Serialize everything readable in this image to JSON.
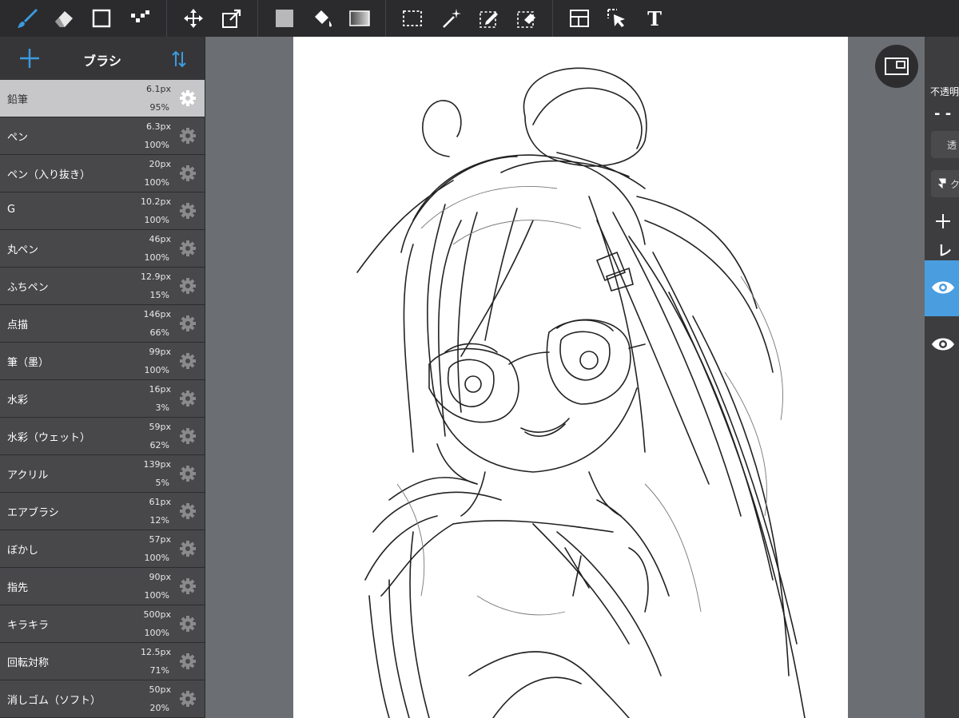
{
  "toolbar": {
    "tools": [
      {
        "name": "brush-tool",
        "icon": "brush-icon",
        "active": true
      },
      {
        "name": "eraser-tool",
        "icon": "eraser-icon"
      },
      {
        "name": "shape-tool",
        "icon": "square-icon"
      },
      {
        "name": "dot-tool",
        "icon": "dots-icon"
      },
      {
        "name": "move-tool",
        "icon": "move-icon"
      },
      {
        "name": "transform-tool",
        "icon": "transform-icon"
      },
      {
        "name": "color-tool",
        "icon": "color-swatch-icon"
      },
      {
        "name": "fill-tool",
        "icon": "bucket-icon"
      },
      {
        "name": "gradient-tool",
        "icon": "gradient-icon"
      },
      {
        "name": "select-rect-tool",
        "icon": "selection-rect-icon"
      },
      {
        "name": "magic-wand-tool",
        "icon": "magic-wand-icon"
      },
      {
        "name": "select-pen-tool",
        "icon": "selection-pen-icon"
      },
      {
        "name": "select-eraser-tool",
        "icon": "selection-eraser-icon"
      },
      {
        "name": "panel-layout-tool",
        "icon": "layout-icon"
      },
      {
        "name": "select-layer-tool",
        "icon": "cursor-select-icon"
      },
      {
        "name": "text-tool",
        "icon": "text-icon"
      }
    ],
    "text_tool_label": "T",
    "accent": "#3b9be0"
  },
  "sidebar": {
    "title": "ブラシ",
    "brushes": [
      {
        "name": "鉛筆",
        "size": "6.1px",
        "opacity": "95%",
        "selected": true
      },
      {
        "name": "ペン",
        "size": "6.3px",
        "opacity": "100%"
      },
      {
        "name": "ペン（入り抜き）",
        "size": "20px",
        "opacity": "100%"
      },
      {
        "name": "G",
        "size": "10.2px",
        "opacity": "100%"
      },
      {
        "name": "丸ペン",
        "size": "46px",
        "opacity": "100%"
      },
      {
        "name": "ふちペン",
        "size": "12.9px",
        "opacity": "15%"
      },
      {
        "name": "点描",
        "size": "146px",
        "opacity": "66%"
      },
      {
        "name": "筆（墨）",
        "size": "99px",
        "opacity": "100%"
      },
      {
        "name": "水彩",
        "size": "16px",
        "opacity": "3%"
      },
      {
        "name": "水彩（ウェット）",
        "size": "59px",
        "opacity": "62%"
      },
      {
        "name": "アクリル",
        "size": "139px",
        "opacity": "5%"
      },
      {
        "name": "エアブラシ",
        "size": "61px",
        "opacity": "12%"
      },
      {
        "name": "ぼかし",
        "size": "57px",
        "opacity": "100%"
      },
      {
        "name": "指先",
        "size": "90px",
        "opacity": "100%"
      },
      {
        "name": "キラキラ",
        "size": "500px",
        "opacity": "100%"
      },
      {
        "name": "回転対称",
        "size": "12.5px",
        "opacity": "71%"
      },
      {
        "name": "消しゴム（ソフト）",
        "size": "50px",
        "opacity": "20%"
      }
    ]
  },
  "right_panel": {
    "opacity_label": "不透明",
    "opacity_value": "- -",
    "blend_button": "透",
    "clip_button": "ク",
    "layer_heading": "レ",
    "layers": [
      {
        "visible": true,
        "selected": true
      },
      {
        "visible": true,
        "selected": false
      }
    ],
    "selected_color": "#4a9ee0"
  }
}
